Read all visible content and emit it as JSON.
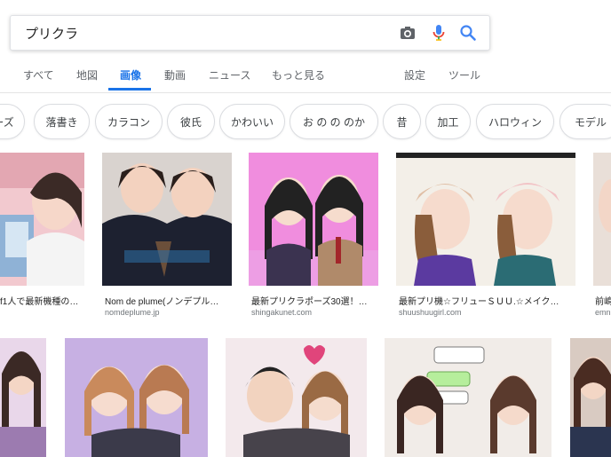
{
  "search": {
    "query": "プリクラ"
  },
  "tabs": [
    "すべて",
    "地図",
    "画像",
    "動画",
    "ニュース",
    "もっと見る",
    "設定",
    "ツール"
  ],
  "chips": [
    "ーズ",
    "落書き",
    "カラコン",
    "彼氏",
    "かわいい",
    "お の の のか",
    "昔",
    "加工",
    "ハロウィン",
    "モデル"
  ],
  "results": [
    {
      "title": "f1人で最新機種の…",
      "source": ""
    },
    {
      "title": "Nom de plume(ノンデプル…",
      "source": "nomdeplume.jp"
    },
    {
      "title": "最新プリクラポーズ30選！…",
      "source": "shingakunet.com"
    },
    {
      "title": "最新プリ機☆フリューＳＵＵ.☆メイク…",
      "source": "shuushuugirl.com"
    },
    {
      "title": "前嶋",
      "source": "emn"
    }
  ],
  "colors": {
    "accent": "#1a73e8",
    "mic_red": "#ea4335",
    "mic_blue": "#4285f4"
  }
}
